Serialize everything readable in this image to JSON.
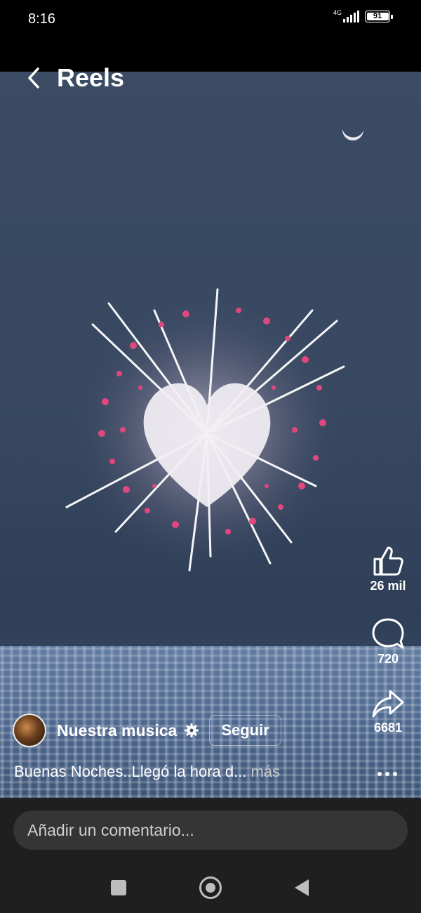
{
  "status_bar": {
    "time": "8:16",
    "network": "4G",
    "battery": "91"
  },
  "header": {
    "title": "Reels",
    "back_icon": "chevron-left-icon"
  },
  "actions": {
    "like": {
      "icon": "thumbs-up-icon",
      "count": "26 mil"
    },
    "comment": {
      "icon": "speech-bubble-icon",
      "count": "720"
    },
    "share": {
      "icon": "share-arrow-icon",
      "count": "6681"
    }
  },
  "author": {
    "name": "Nuestra musica",
    "badge_icon": "gear-icon",
    "follow_label": "Seguir"
  },
  "caption": {
    "text": "Buenas Noches..Llegó la hora d...",
    "more": "más"
  },
  "comment_bar": {
    "placeholder": "Añadir un comentario..."
  },
  "nav_bar": {
    "recents_icon": "square-icon",
    "home_icon": "circle-home-icon",
    "back_icon": "triangle-back-icon"
  },
  "colors": {
    "sky": "#3a4b63",
    "sea": "#51678a",
    "bar_bg": "#1f1f1f",
    "input_bg": "#353535",
    "firework_pink": "#e0477e"
  }
}
